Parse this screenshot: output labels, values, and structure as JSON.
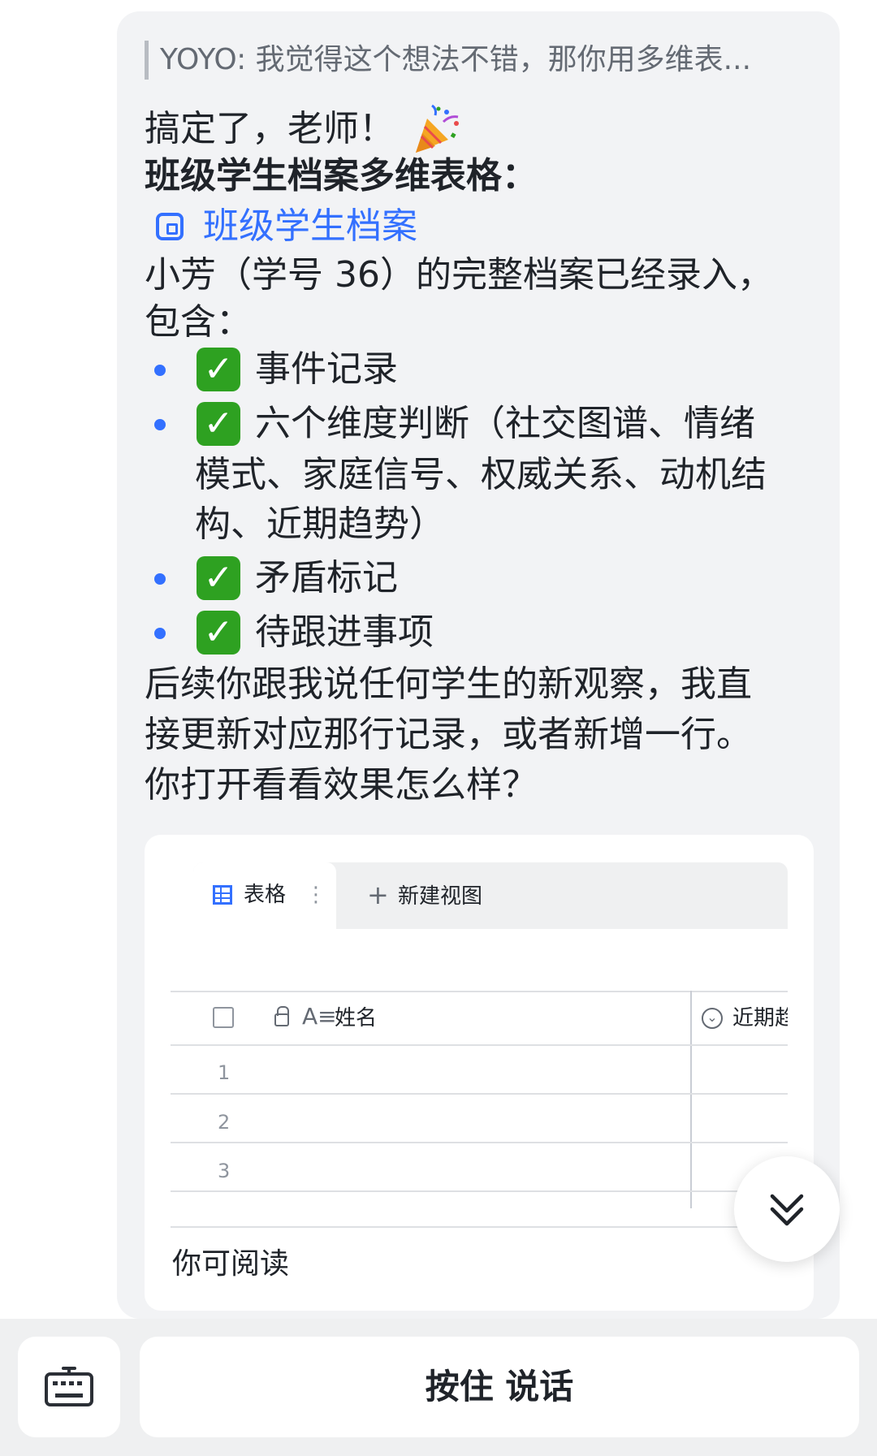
{
  "message": {
    "quote": "YOYO: 我觉得这个想法不错，那你用多维表...",
    "greeting": "搞定了，老师！",
    "heading": "班级学生档案多维表格：",
    "doc_link": "班级学生档案",
    "intro_line1": "小芳（学号 36）的完整档案已经录入，",
    "intro_line2": "包含：",
    "items": [
      {
        "check": "✓",
        "lines": [
          "事件记录"
        ]
      },
      {
        "check": "✓",
        "lines": [
          "六个维度判断（社交图谱、情绪",
          "模式、家庭信号、权威关系、动机结",
          "构、近期趋势）"
        ]
      },
      {
        "check": "✓",
        "lines": [
          "矛盾标记"
        ]
      },
      {
        "check": "✓",
        "lines": [
          "待跟进事项"
        ]
      }
    ],
    "outro": [
      "后续你跟我说任何学生的新观察，我直",
      "接更新对应那行记录，或者新增一行。",
      "你打开看看效果怎么样？"
    ]
  },
  "table_preview": {
    "tab_active": "表格",
    "tab_new": "新建视图",
    "columns": [
      "姓名",
      "近期趋"
    ],
    "row_numbers": [
      "1",
      "2",
      "3"
    ],
    "footer": "你可阅读"
  },
  "input_bar": {
    "talk_label": "按住 说话"
  },
  "icons": {
    "doc": "bitable-icon",
    "grid": "grid-view-icon",
    "scroll": "scroll-down-icon",
    "keyboard": "keyboard-icon"
  },
  "colors": {
    "accent": "#3370ff",
    "check_green": "#2ea121",
    "bubble_bg": "#f2f3f5"
  }
}
